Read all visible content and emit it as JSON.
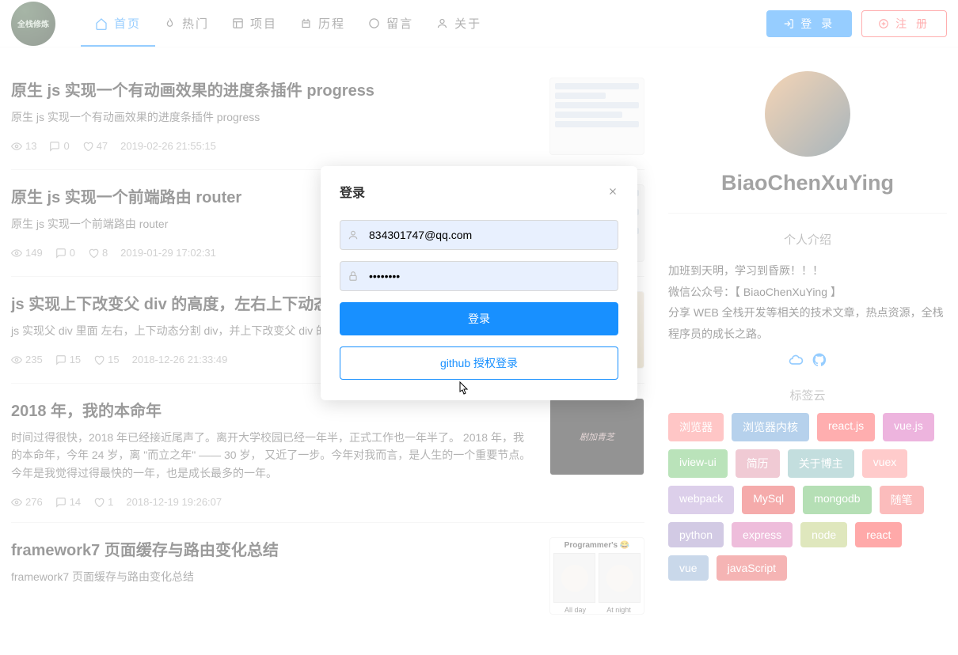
{
  "header": {
    "logo_text": "全栈修炼",
    "nav": [
      {
        "label": "首页",
        "icon": "home-icon",
        "active": true
      },
      {
        "label": "热门",
        "icon": "fire-icon",
        "active": false
      },
      {
        "label": "项目",
        "icon": "layout-icon",
        "active": false
      },
      {
        "label": "历程",
        "icon": "timeline-icon",
        "active": false
      },
      {
        "label": "留言",
        "icon": "message-icon",
        "active": false
      },
      {
        "label": "关于",
        "icon": "user-icon",
        "active": false
      }
    ],
    "login_label": "登 录",
    "register_label": "注 册"
  },
  "articles": [
    {
      "title": "原生 js 实现一个有动画效果的进度条插件 progress",
      "summary": "原生 js 实现一个有动画效果的进度条插件 progress",
      "views": "13",
      "comments": "0",
      "likes": "47",
      "date": "2019-02-26 21:55:15",
      "thumb": "lines"
    },
    {
      "title": "原生 js 实现一个前端路由 router",
      "summary": "原生 js 实现一个前端路由 router",
      "views": "149",
      "comments": "0",
      "likes": "8",
      "date": "2019-01-29 17:02:31",
      "thumb": "lines"
    },
    {
      "title": "js 实现上下改变父 div 的高度，左右上下动态分割…",
      "summary": "js 实现父 div 里面 左右，上下动态分割 div，并上下改变父 div 的高…",
      "views": "235",
      "comments": "15",
      "likes": "15",
      "date": "2018-12-26 21:33:49",
      "thumb": "poster"
    },
    {
      "title": "2018 年，我的本命年",
      "summary": "时间过得很快，2018 年已经接近尾声了。离开大学校园已经一年半，正式工作也一年半了。 2018 年，我的本命年，今年 24 岁，离 \"而立之年\" —— 30 岁， 又近了一步。今年对我而言，是人生的一个重要节点。今年是我觉得过得最快的一年，也是成长最多的一年。",
      "views": "276",
      "comments": "14",
      "likes": "1",
      "date": "2018-12-19 19:26:07",
      "thumb": "dark"
    },
    {
      "title": "framework7 页面缓存与路由变化总结",
      "summary": "framework7 页面缓存与路由变化总结",
      "views": "",
      "comments": "",
      "likes": "",
      "date": "",
      "thumb": "programmer"
    }
  ],
  "sidebar": {
    "username": "BiaoChenXuYing",
    "bio_title": "个人介绍",
    "bio_lines": [
      "加班到天明，学习到昏厥！！！",
      "微信公众号：【 BiaoChenXuYing 】",
      "分享 WEB 全栈开发等相关的技术文章，热点资源，全栈程序员的成长之路。"
    ],
    "tag_cloud_title": "标签云",
    "tags": [
      {
        "label": "浏览器",
        "color": "#ff8080"
      },
      {
        "label": "浏览器内核",
        "color": "#5e9ad6"
      },
      {
        "label": "react.js",
        "color": "#ff4d4f"
      },
      {
        "label": "vue.js",
        "color": "#d759b6"
      },
      {
        "label": "iview-ui",
        "color": "#66c266"
      },
      {
        "label": "简历",
        "color": "#de8aa0"
      },
      {
        "label": "关于博主",
        "color": "#7bb5b5"
      },
      {
        "label": "vuex",
        "color": "#ff8c8c"
      },
      {
        "label": "webpack",
        "color": "#b296d1"
      },
      {
        "label": "MySql",
        "color": "#e84545"
      },
      {
        "label": "mongodb",
        "color": "#5cb85c"
      },
      {
        "label": "随笔",
        "color": "#f56c6c"
      },
      {
        "label": "python",
        "color": "#9b8bc4"
      },
      {
        "label": "express",
        "color": "#d96db0"
      },
      {
        "label": "node",
        "color": "#b8c96e"
      },
      {
        "label": "react",
        "color": "#ff4040"
      },
      {
        "label": "vue",
        "color": "#87a8d0"
      },
      {
        "label": "javaScript",
        "color": "#e85a5a"
      }
    ]
  },
  "modal": {
    "title": "登录",
    "email_value": "834301747@qq.com",
    "password_value": "••••••••",
    "login_btn": "登录",
    "github_btn": "github 授权登录"
  },
  "thumbs": {
    "dark_text": "剧加青芝",
    "programmer_title": "Programmer's 😂",
    "programmer_left": "All day",
    "programmer_right": "At night"
  }
}
